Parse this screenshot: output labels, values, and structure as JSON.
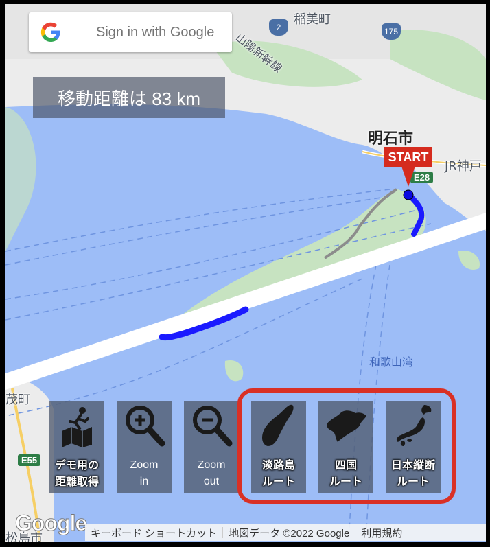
{
  "signin": {
    "label": "Sign in with Google"
  },
  "distance": {
    "text": "移動距離は 83 km"
  },
  "map": {
    "city_label": "明石市",
    "start_marker": "START",
    "labels": {
      "town_top": "稲美町",
      "bay": "和歌山湾",
      "jr": "JR神戸",
      "left_town": "茂町",
      "left_city": "松島市",
      "rail": "山陽新幹線"
    },
    "shields": {
      "e28": "E28",
      "e55": "E55",
      "r2": "2",
      "r175": "175"
    },
    "route_color": "#1a1aff"
  },
  "buttons": [
    {
      "label_line1": "デモ用の",
      "label_line2": "距離取得",
      "icon": "runner-map-icon"
    },
    {
      "label_line1": "Zoom",
      "label_line2": "in",
      "icon": "zoom-in-icon"
    },
    {
      "label_line1": "Zoom",
      "label_line2": "out",
      "icon": "zoom-out-icon"
    },
    {
      "label_line1": "淡路島",
      "label_line2": "ルート",
      "icon": "awaji-island-icon"
    },
    {
      "label_line1": "四国",
      "label_line2": "ルート",
      "icon": "shikoku-icon"
    },
    {
      "label_line1": "日本縦断",
      "label_line2": "ルート",
      "icon": "japan-icon"
    }
  ],
  "footer": {
    "logo": "Google",
    "shortcuts": "キーボード ショートカット",
    "map_data": "地図データ ©2022 Google",
    "terms": "利用規約"
  },
  "colors": {
    "water": "#9dbdf7",
    "land": "#f0f0f0",
    "green_land": "#c7e3c1",
    "highlight": "#d93025",
    "start": "#d52b1e"
  }
}
